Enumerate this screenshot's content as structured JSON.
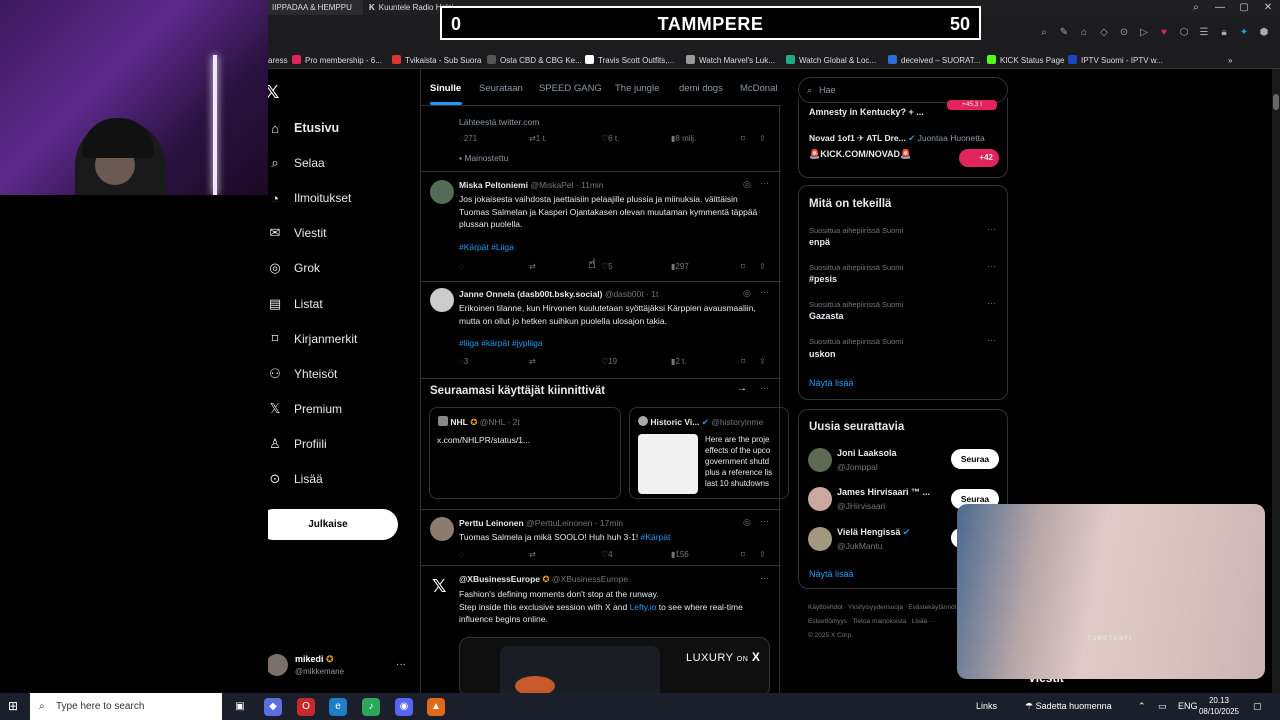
{
  "browser": {
    "tabs": [
      "IIPPADAA & HEMPPU",
      "Kuuntele Radio Helsi..."
    ],
    "bookmarks": [
      {
        "label": "aress",
        "color": "#444"
      },
      {
        "label": "Pro membership - 6...",
        "color": "#e0245e"
      },
      {
        "label": "Tvikaista - Sub Suora",
        "color": "#d33"
      },
      {
        "label": "Osta CBD & CBG Ke...",
        "color": "#555"
      },
      {
        "label": "Travis Scott Outfits,...",
        "color": "#fff"
      },
      {
        "label": "Watch Marvel's Luk...",
        "color": "#999"
      },
      {
        "label": "Watch Global & Loc...",
        "color": "#2a8"
      },
      {
        "label": "deceived – SUORAT...",
        "color": "#2b6fd6"
      },
      {
        "label": "KICK Status Page",
        "color": "#53fc18"
      },
      {
        "label": "IPTV Suomi - IPTV w...",
        "color": "#1947c2"
      }
    ]
  },
  "scoreboard": {
    "left": "0",
    "title": "TAMMPERE",
    "right": "50"
  },
  "nav": {
    "items": [
      {
        "label": "Etusivu",
        "icon": "home-icon",
        "glyph": "⌂"
      },
      {
        "label": "Selaa",
        "icon": "search-icon",
        "glyph": "⌕"
      },
      {
        "label": "Ilmoitukset",
        "icon": "bell-icon",
        "glyph": "🔔︎"
      },
      {
        "label": "Viestit",
        "icon": "mail-icon",
        "glyph": "✉"
      },
      {
        "label": "Grok",
        "icon": "grok-icon",
        "glyph": "◎"
      },
      {
        "label": "Listat",
        "icon": "list-icon",
        "glyph": "▤"
      },
      {
        "label": "Kirjanmerkit",
        "icon": "bookmark-icon",
        "glyph": "⌑"
      },
      {
        "label": "Yhteisöt",
        "icon": "communities-icon",
        "glyph": "⚇"
      },
      {
        "label": "Premium",
        "icon": "premium-x-icon",
        "glyph": "X"
      },
      {
        "label": "Profiili",
        "icon": "profile-icon",
        "glyph": "♙"
      },
      {
        "label": "Lisää",
        "icon": "more-icon",
        "glyph": "⋯"
      }
    ],
    "post_label": "Julkaise",
    "account": {
      "name": "mikedi",
      "handle": "@mikkemane"
    }
  },
  "feed": {
    "tabs": [
      "Sinulle",
      "Seurataan",
      "SPEED GANG",
      "The jungle",
      "demi dogs",
      "McDonal"
    ],
    "ad": {
      "source": "Lähteestä twitter.com",
      "replies": "271",
      "reposts": "1 t.",
      "likes": "6 t.",
      "views": "8 milj.",
      "promoted": "Mainostettu"
    },
    "tweets": [
      {
        "name": "Miska Peltoniemi",
        "handle": "@MiskaPel · 11min",
        "text": "Jos jokaisesta vaihdosta jaettaisiin pelaajille plussia ja miinuksia. väittäisin Tuomas Salmelan ja Kasperi Ojantakasen olevan muutaman kymmentä täppää plussan puolella.",
        "tags": "#Kärpät #Liiga",
        "replies": "",
        "reposts": "",
        "likes": "5",
        "views": "297"
      },
      {
        "name": "Janne Onnela (dasb00t.bsky.social)",
        "handle": "@dasb00t · 1t",
        "text": "Erikoinen tilanne, kun Hirvonen kuulutetaan syöttäjäksi Kärppien avausmaaliin, mutta on ollut jo hetken suihkun puolella ulosajon takia.",
        "tags": "#liiga #kärpät #jypliiga",
        "replies": "3",
        "reposts": "",
        "likes": "19",
        "views": "2 t."
      },
      {
        "name": "Perttu Leinonen",
        "handle": "@PerttuLeinonen · 17min",
        "text": "Tuomas Salmela ja mikä SOOLO! Huh huh 3-1!",
        "tag_inline": "#Kärpät",
        "replies": "",
        "reposts": "",
        "likes": "4",
        "views": "156"
      },
      {
        "name": "@XBusinessEurope",
        "handle": "@XBusinessEurope",
        "text1": "Fashion's defining moments don't stop at the runway.",
        "text2": "Step inside this exclusive session with X and",
        "link": "Lefty.io",
        "text3": "to see where real-time influence begins online.",
        "media_label": "LUXURY",
        "media_on": "ON",
        "media_x": "X"
      }
    ],
    "pinned": {
      "title": "Seuraamasi käyttäjät kiinnittivät",
      "cards": [
        {
          "name": "NHL",
          "handle": "@NHL · 2t",
          "text": "x.com/NHLPR/status/1..."
        },
        {
          "name": "Historic Vi...",
          "handle": "@historyinme",
          "text": "Here are the proje effects of the upco government shutd plus a reference lis last 10 shutdowns"
        }
      ]
    }
  },
  "right": {
    "search_placeholder": "Hae",
    "top_box": {
      "line1": "Amnesty in Kentucky? + ...",
      "line2": "Novad 1of1 ✈ ATL Dre...",
      "line3": "Juontaa Huonetta",
      "line4": "🚨KICK.COM/NOVAD🚨",
      "count": "+42",
      "count_top": "+45,3 t"
    },
    "trends_title": "Mitä on tekeillä",
    "trends": [
      {
        "meta": "Suosittua aihepiirissä Suomi",
        "name": "enpä"
      },
      {
        "meta": "Suosittua aihepiirissä Suomi",
        "name": "#pesis"
      },
      {
        "meta": "Suosittua aihepiirissä Suomi",
        "name": "Gazasta"
      },
      {
        "meta": "Suosittua aihepiirissä Suomi",
        "name": "uskon"
      }
    ],
    "show_more": "Näytä lisää",
    "who_title": "Uusia seurattavia",
    "who": [
      {
        "name": "Joni Laaksola",
        "handle": "@Jomppal"
      },
      {
        "name": "James Hirvisaari ™ ...",
        "handle": "@JHirvisaari"
      },
      {
        "name": "Vielä Hengissä",
        "handle": "@JukMantu"
      }
    ],
    "follow_label": "Seuraa",
    "footer": [
      "Käyttöehdot",
      "Yksityisyydensuoja",
      "Evästekäytännöt",
      "Esteettömyys",
      "Tietoa mainoksista",
      "Lisää ···",
      "© 2025 X Corp."
    ]
  },
  "webcam": {
    "label": "TUBETUBFI"
  },
  "messages_label": "Viestit",
  "taskbar": {
    "search_placeholder": "Type here to search",
    "links": "Links",
    "weather": "Sadetta huomenna",
    "lang": "ENG",
    "time": "20.13",
    "date": "08/10/2025"
  }
}
